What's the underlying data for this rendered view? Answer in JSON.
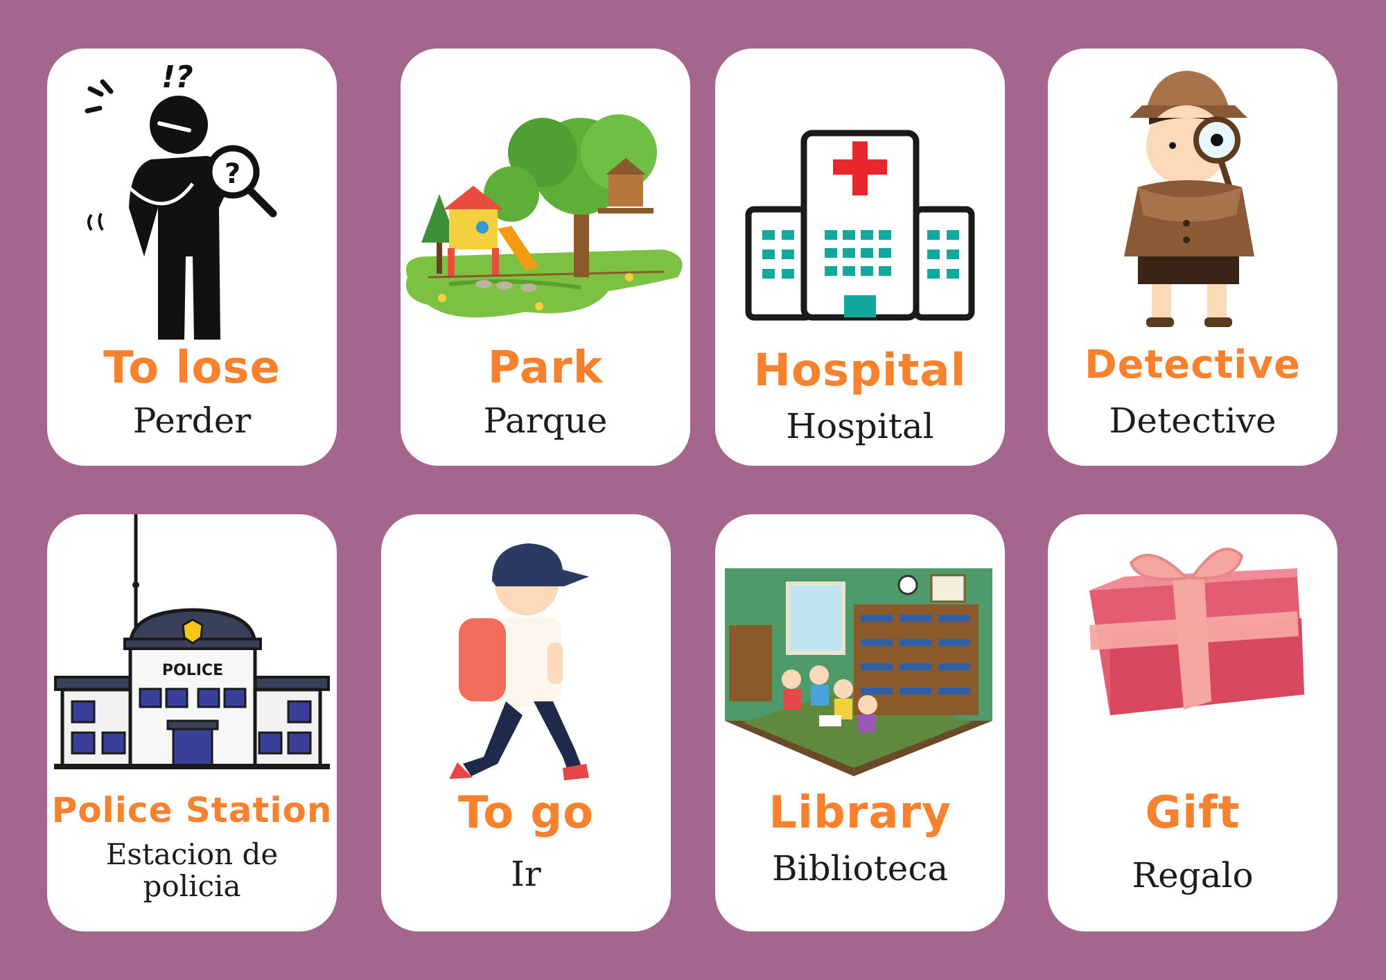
{
  "cards": [
    {
      "english": "To lose",
      "spanish": "Perder",
      "icon": "confused-person-icon"
    },
    {
      "english": "Park",
      "spanish": "Parque",
      "icon": "park-playground-icon"
    },
    {
      "english": "Hospital",
      "spanish": "Hospital",
      "icon": "hospital-building-icon"
    },
    {
      "english": "Detective",
      "spanish": "Detective",
      "icon": "detective-icon"
    },
    {
      "english": "Police Station",
      "spanish": "Estacion de policia",
      "icon": "police-station-icon",
      "sign": "POLICE"
    },
    {
      "english": "To go",
      "spanish": "Ir",
      "icon": "walking-boy-icon"
    },
    {
      "english": "Library",
      "spanish": "Biblioteca",
      "icon": "library-room-icon"
    },
    {
      "english": "Gift",
      "spanish": "Regalo",
      "icon": "gift-box-icon"
    }
  ],
  "colors": {
    "background": "#a5668d",
    "card": "#ffffff",
    "title": "#f7812d",
    "subtitle": "#1c1c1c"
  }
}
